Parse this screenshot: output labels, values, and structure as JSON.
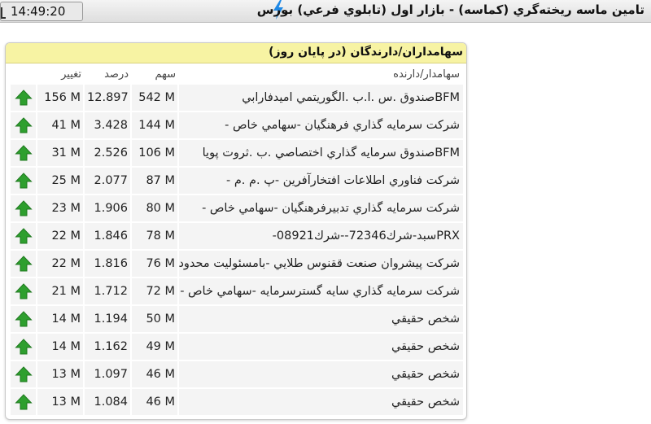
{
  "app": {
    "clock": "14:49:20",
    "title": "تامين ماسه ريخته‌گري (كماسه) - بازار اول (تابلوي فرعي) بورس"
  },
  "panel": {
    "title": "سهامداران/دارندگان (در پايان روز)",
    "columns": {
      "holder": "سهامدار/دارنده",
      "shares": "سهم",
      "percent": "درصد",
      "change": "تغيير"
    },
    "rows": [
      {
        "holder": "BFMصندوق .س .ا.ب .الگوريتمي اميدفارابي",
        "shares": "542 M",
        "percent": "12.897",
        "change": "156 M",
        "trend": "up-arrow-icon"
      },
      {
        "holder": "شركت سرمايه گذاري فرهنگيان -سهامي خاص -",
        "shares": "144 M",
        "percent": "3.428",
        "change": "41 M",
        "trend": "up-arrow-icon"
      },
      {
        "holder": "BFMصندوق سرمايه گذاري اختصاصي .ب .ثروت پويا",
        "shares": "106 M",
        "percent": "2.526",
        "change": "31 M",
        "trend": "up-arrow-icon"
      },
      {
        "holder": "شركت فناوري اطلاعات افتخارآفرين -پ .م .م -",
        "shares": "87 M",
        "percent": "2.077",
        "change": "25 M",
        "trend": "up-arrow-icon"
      },
      {
        "holder": "شركت سرمايه گذاري تدبيرفرهنگيان -سهامي خاص -",
        "shares": "80 M",
        "percent": "1.906",
        "change": "23 M",
        "trend": "up-arrow-icon"
      },
      {
        "holder": "PRXسبد-شرك72346--شرك08921-",
        "shares": "78 M",
        "percent": "1.846",
        "change": "22 M",
        "trend": "up-arrow-icon"
      },
      {
        "holder": "شركت پيشروان صنعت ققنوس طلايي -بامسئوليت محدود",
        "shares": "76 M",
        "percent": "1.816",
        "change": "22 M",
        "trend": "up-arrow-icon"
      },
      {
        "holder": "شركت سرمايه گذاري سايه گسترسرمايه -سهامي خاص -",
        "shares": "72 M",
        "percent": "1.712",
        "change": "21 M",
        "trend": "up-arrow-icon"
      },
      {
        "holder": "شخص حقيقي",
        "shares": "50 M",
        "percent": "1.194",
        "change": "14 M",
        "trend": "up-arrow-icon"
      },
      {
        "holder": "شخص حقيقي",
        "shares": "49 M",
        "percent": "1.162",
        "change": "14 M",
        "trend": "up-arrow-icon"
      },
      {
        "holder": "شخص حقيقي",
        "shares": "46 M",
        "percent": "1.097",
        "change": "13 M",
        "trend": "up-arrow-icon"
      },
      {
        "holder": "شخص حقيقي",
        "shares": "46 M",
        "percent": "1.084",
        "change": "13 M",
        "trend": "up-arrow-icon"
      }
    ]
  },
  "colors": {
    "header_bar": "#f7f3a3",
    "row_background": "#f4f4f4",
    "up_arrow": "#2e9f2e",
    "bolt": "#1e88e5"
  },
  "icons": {
    "bolt": "lightning-bolt-icon",
    "clock": "clock-icon",
    "trend_up": "up-arrow-icon"
  }
}
